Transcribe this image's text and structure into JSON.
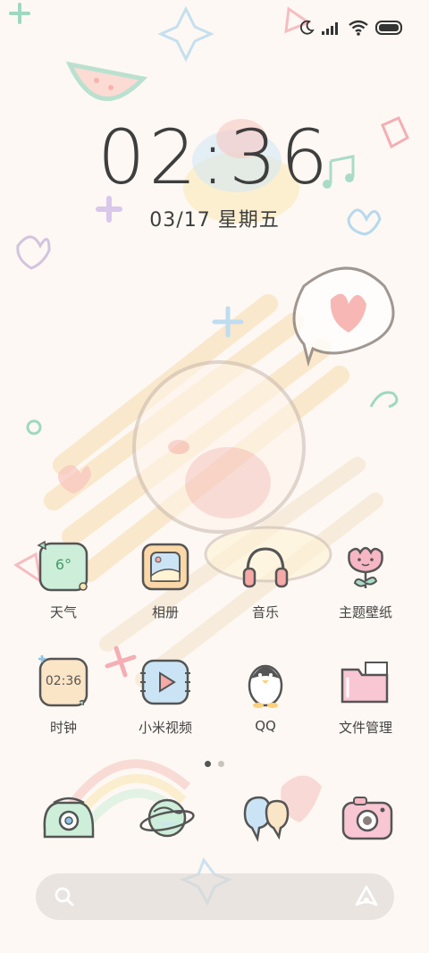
{
  "status_bar": {
    "icons": [
      "moon-icon",
      "signal-icon",
      "wifi-icon",
      "battery-icon"
    ]
  },
  "clock": {
    "time": "02:36",
    "date": "03/17 星期五"
  },
  "apps": {
    "row1": [
      {
        "label": "天气",
        "icon": "weather-icon",
        "temperature": "6°"
      },
      {
        "label": "相册",
        "icon": "gallery-icon"
      },
      {
        "label": "音乐",
        "icon": "headphones-icon"
      },
      {
        "label": "主题壁纸",
        "icon": "tulip-icon"
      }
    ],
    "row2": [
      {
        "label": "时钟",
        "icon": "clock-icon",
        "time": "02:36"
      },
      {
        "label": "小米视频",
        "icon": "video-icon"
      },
      {
        "label": "QQ",
        "icon": "penguin-icon"
      },
      {
        "label": "文件管理",
        "icon": "folder-icon"
      }
    ]
  },
  "page_indicator": {
    "total": 2,
    "active": 1
  },
  "dock": [
    {
      "icon": "phone-icon"
    },
    {
      "icon": "planet-icon"
    },
    {
      "icon": "chat-bubbles-icon"
    },
    {
      "icon": "camera-icon"
    }
  ],
  "search_bar": {
    "icons": [
      "search-icon",
      "ai-assistant-icon"
    ]
  },
  "colors": {
    "background": "#fdf8f3",
    "text": "#3e3e3e",
    "weather_tile": "#cdeed9",
    "gallery_tile": "#fbd8a8",
    "video_tile": "#cbe4f5",
    "folder_tile": "#f9c6d4",
    "clock_tile": "#fbe5c7"
  }
}
